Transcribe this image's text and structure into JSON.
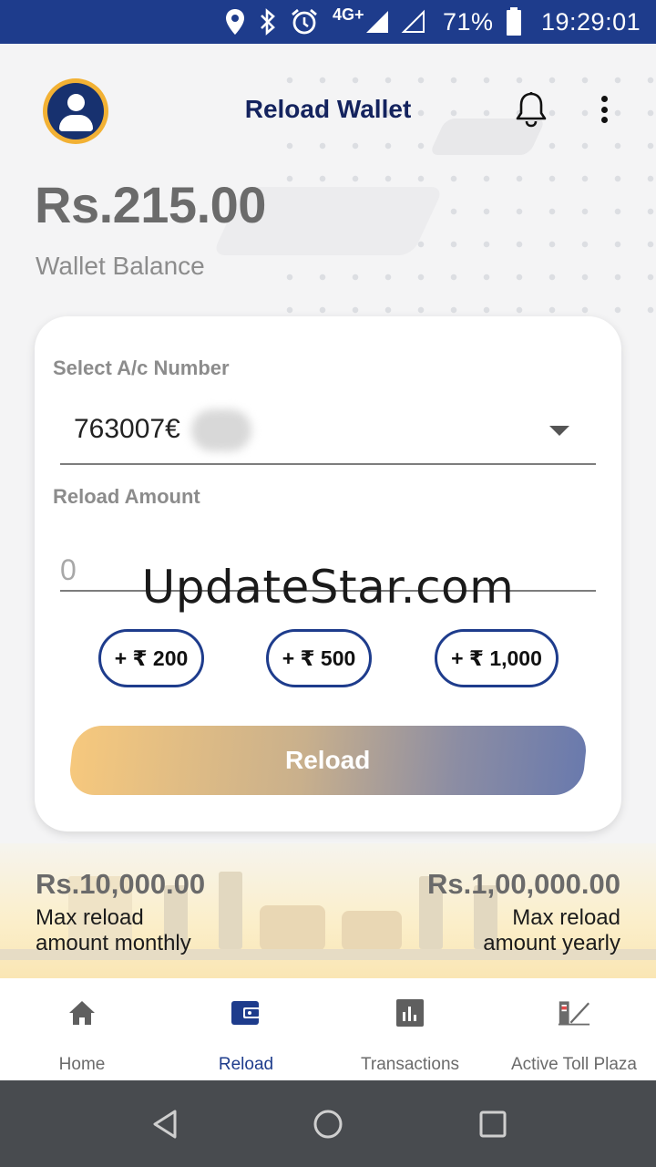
{
  "status_bar": {
    "network": "4G+",
    "battery": "71%",
    "time": "19:29:01"
  },
  "header": {
    "title": "Reload Wallet"
  },
  "wallet": {
    "balance": "Rs.215.00",
    "balance_label": "Wallet Balance"
  },
  "form": {
    "account_label": "Select A/c Number",
    "account_value": "763007€",
    "amount_label": "Reload Amount",
    "amount_placeholder": "0",
    "quick_amounts": [
      "+ ₹ 200",
      "+ ₹ 500",
      "+ ₹ 1,000"
    ],
    "reload_button": "Reload"
  },
  "limits": {
    "monthly_amount": "Rs.10,000.00",
    "monthly_label_1": "Max reload",
    "monthly_label_2": "amount monthly",
    "yearly_amount": "Rs.1,00,000.00",
    "yearly_label_1": "Max reload",
    "yearly_label_2": "amount yearly"
  },
  "bottom_nav": {
    "items": [
      {
        "label": "Home",
        "icon": "home-icon"
      },
      {
        "label": "Reload",
        "icon": "wallet-icon"
      },
      {
        "label": "Transactions",
        "icon": "chart-icon"
      },
      {
        "label": "Active Toll Plaza",
        "icon": "toll-plaza-icon"
      }
    ],
    "active_index": 1
  },
  "watermark": "UpdateStar.com",
  "colors": {
    "primary": "#1e3c8c",
    "accent": "#f2b134",
    "reload_gradient_start": "#f6c87d",
    "reload_gradient_end": "#6a7aad"
  }
}
